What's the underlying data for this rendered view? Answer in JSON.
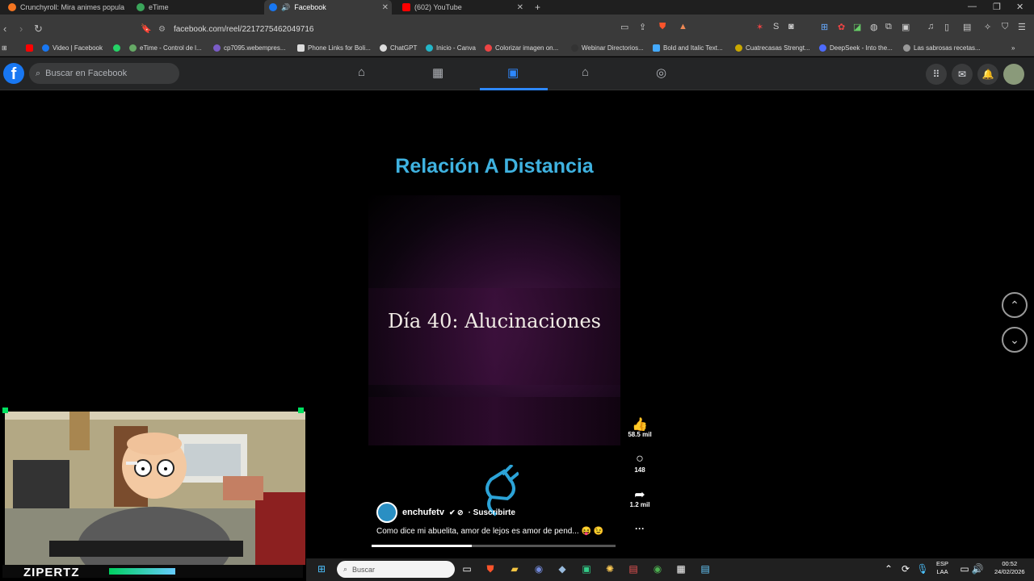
{
  "browser": {
    "tabs": [
      {
        "title": "Crunchyroll: Mira animes populares,",
        "active": false
      },
      {
        "title": "eTime",
        "active": false
      },
      {
        "title": "Facebook",
        "active": true
      },
      {
        "title": "(602) YouTube",
        "active": false
      }
    ],
    "new_tab": "+",
    "url": "facebook.com/reel/2217275462049716",
    "bookmarks": [
      "Video | Facebook",
      "eTime - Control de l...",
      "cp7095.webempres...",
      "Phone Links for Boli...",
      "ChatGPT",
      "Inicio - Canva",
      "Colorizar imagen on...",
      "Webinar Directorios...",
      "Bold and Italic Text...",
      "Cuatrecasas Strengt...",
      "DeepSeek - Into the...",
      "Las sabrosas recetas..."
    ],
    "accent": "#1877f2"
  },
  "facebook": {
    "search_placeholder": "Buscar en Facebook",
    "nav": [
      "home-icon",
      "video-icon",
      "reels-icon",
      "marketplace-icon",
      "groups-icon"
    ],
    "active_nav": "reels"
  },
  "reel": {
    "title": "Relación A Distancia",
    "caption": "Día 40: Alucinaciones",
    "username": "enchufetv",
    "subscribe": "· Suscribirte",
    "description": "Como dice mi abuelita, amor de lejos es amor de pend...",
    "likes": "58.5 mil",
    "comments": "148",
    "shares": "1.2 mil",
    "more": "···",
    "progress": 0.41,
    "title_color": "#3fb2e0"
  },
  "webcam": {
    "label": "ZIPERTZ"
  },
  "taskbar": {
    "search": "Buscar",
    "lang": "ESP",
    "lang2": "LAA",
    "time": "00:52",
    "date": "24/02/2026"
  }
}
